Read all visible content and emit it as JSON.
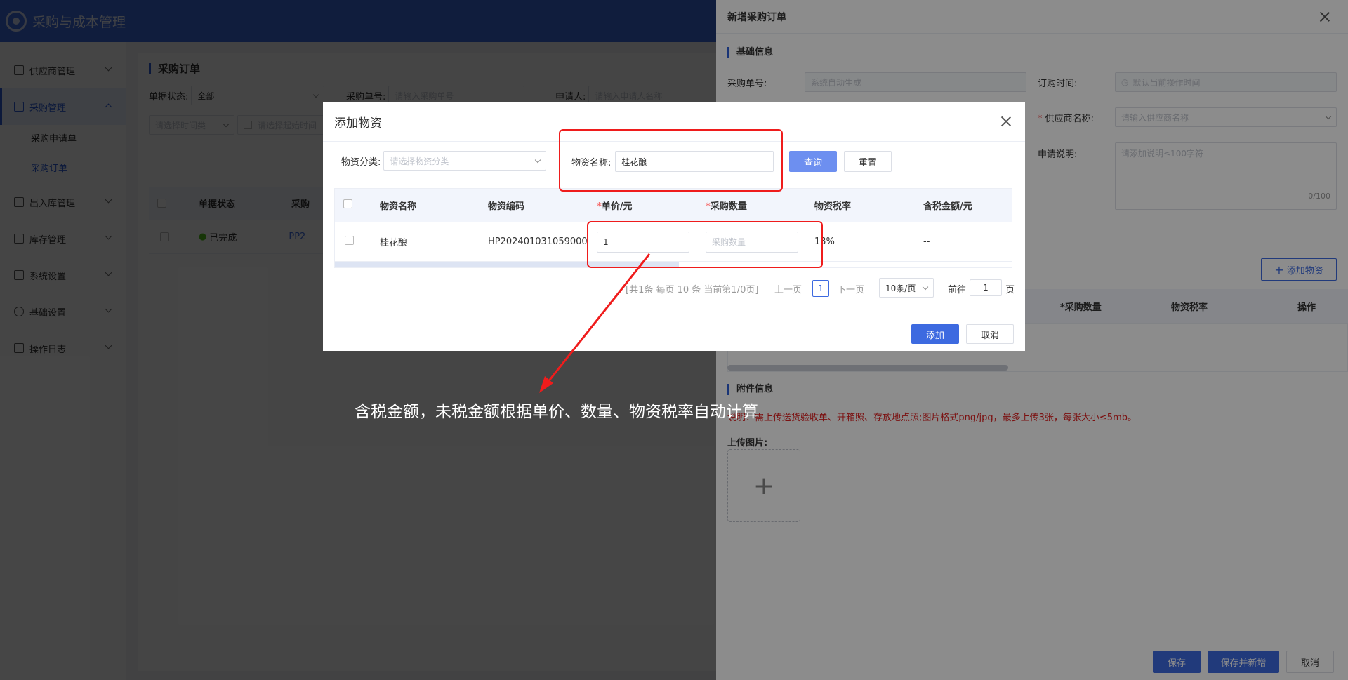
{
  "app": {
    "title": "采购与成本管理"
  },
  "sidebar": {
    "items": [
      {
        "label": "供应商管理"
      },
      {
        "label": "采购管理"
      },
      {
        "label": "采购申请单"
      },
      {
        "label": "采购订单"
      },
      {
        "label": "出入库管理"
      },
      {
        "label": "库存管理"
      },
      {
        "label": "系统设置"
      },
      {
        "label": "基础设置"
      },
      {
        "label": "操作日志"
      }
    ]
  },
  "page": {
    "title": "采购订单",
    "status_label": "单据状态:",
    "status_value": "全部",
    "order_no_label": "采购单号:",
    "order_no_placeholder": "请输入采购单号",
    "applicant_label": "申请人:",
    "applicant_placeholder": "请输入申请人名称",
    "time_type_placeholder": "请选择时间类",
    "start_time_placeholder": "请选择起始时间",
    "table_headers": [
      "单据状态",
      "采购"
    ],
    "row": {
      "status": "已完成",
      "order_prefix": "PP2"
    }
  },
  "drawer": {
    "title": "新增采购订单",
    "basic_section": "基础信息",
    "order_no_label": "采购单号:",
    "order_no_placeholder": "系统自动生成",
    "order_time_label": "订购时间:",
    "order_time_placeholder": "默认当前操作时间",
    "supplier_label": "供应商名称:",
    "supplier_placeholder": "请输入供应商名称",
    "desc_label": "申请说明:",
    "desc_placeholder": "请添加说明≤100字符",
    "desc_count": "0/100",
    "add_material": "添加物资",
    "table_headers": [
      "*采购数量",
      "物资税率",
      "操作"
    ],
    "attach_section": "附件信息",
    "attach_note_start": "说明：",
    "attach_note": "需上传送货验收单、开箱照、存放地点照;图片格式png/jpg，最多上传3张，每张大小≤5mb。",
    "upload_label": "上传图片:",
    "save": "保存",
    "save_new": "保存并新增",
    "cancel": "取消"
  },
  "dialog": {
    "title": "添加物资",
    "category_label": "物资分类:",
    "category_placeholder": "请选择物资分类",
    "name_label": "物资名称:",
    "name_value": "桂花酿",
    "query": "查询",
    "reset": "重置",
    "headers": [
      "物资名称",
      "物资编码",
      "单价/元",
      "采购数量",
      "物资税率",
      "含税金额/元"
    ],
    "row": {
      "name": "桂花酿",
      "code": "HP202401031059000",
      "price": "1",
      "qty_placeholder": "采购数量",
      "tax": "13%",
      "amount": "--"
    },
    "pagination": {
      "summary": "[共1条 每页 10 条 当前第1/0页]",
      "prev": "上一页",
      "page": "1",
      "next": "下一页",
      "size": "10条/页",
      "goto": "前往",
      "goto_page": "1",
      "page_unit": "页"
    },
    "confirm": "添加",
    "cancel": "取消"
  },
  "annotation": {
    "text": "含税金额，未税金额根据单价、数量、物资税率自动计算"
  }
}
